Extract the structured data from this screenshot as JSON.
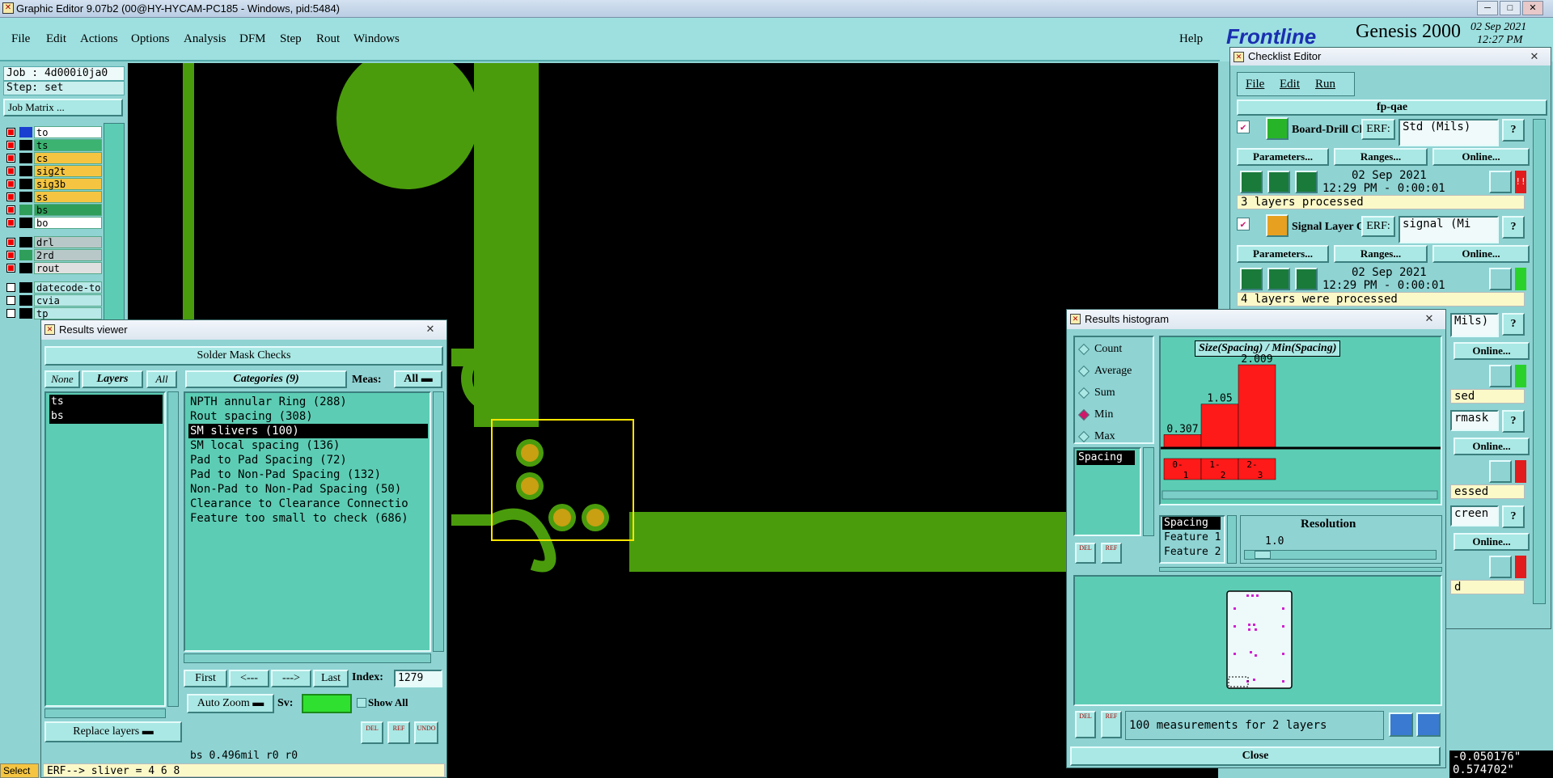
{
  "titlebar": {
    "title": "Graphic Editor 9.07b2 (00@HY-HYCAM-PC185 - Windows, pid:5484)",
    "min": "─",
    "max": "□",
    "close": "✕"
  },
  "menu": {
    "items": [
      "File",
      "Edit",
      "Actions",
      "Options",
      "Analysis",
      "DFM",
      "Step",
      "Rout",
      "Windows"
    ],
    "help": "Help"
  },
  "brand": {
    "logo": "Frontline",
    "product": "Genesis 2000",
    "date": "02 Sep 2021",
    "time": "12:27 PM"
  },
  "left": {
    "job": "Job : 4d000i0ja0",
    "step": "Step: set",
    "job_matrix": "Job Matrix ...",
    "layers": [
      {
        "name": "to",
        "color": "#ffffff",
        "checked": true
      },
      {
        "name": "ts",
        "color": "#3cb371",
        "checked": true
      },
      {
        "name": "cs",
        "color": "#f5c542",
        "checked": true
      },
      {
        "name": "sig2t",
        "color": "#f5c542",
        "checked": true
      },
      {
        "name": "sig3b",
        "color": "#f5c542",
        "checked": true
      },
      {
        "name": "ss",
        "color": "#f5c542",
        "checked": true
      },
      {
        "name": "bs",
        "color": "#2f9e5a",
        "checked": true
      },
      {
        "name": "bo",
        "color": "#ffffff",
        "checked": true
      },
      {
        "name": "drl",
        "color": "#b8c8c8",
        "checked": true
      },
      {
        "name": "2rd",
        "color": "#b8c8c8",
        "checked": true
      },
      {
        "name": "rout",
        "color": "#e0e0e0",
        "checked": true
      },
      {
        "name": "datecode-to",
        "color": "#b8e8e8",
        "checked": false
      },
      {
        "name": "cvia",
        "color": "#b8e8e8",
        "checked": false
      },
      {
        "name": "tp",
        "color": "#b8e8e8",
        "checked": false
      }
    ]
  },
  "results_viewer": {
    "title": "Results viewer",
    "close": "✕",
    "header": "Solder Mask Checks",
    "none": "None",
    "layers": "Layers",
    "all": "All",
    "categories_label": "Categories (9)",
    "meas_label": "Meas:",
    "meas_value": "All",
    "layer_list": [
      "ts",
      "bs"
    ],
    "categories": [
      "NPTH annular Ring (288)",
      "Rout spacing (308)",
      "SM slivers (100)",
      "SM local spacing (136)",
      "Pad to Pad Spacing (72)",
      "Pad to Non-Pad Spacing (132)",
      "Non-Pad to Non-Pad Spacing (50)",
      "Clearance to Clearance Connectio",
      "Feature too small to check (686)"
    ],
    "first": "First",
    "prev": "<---",
    "next": "--->",
    "last": "Last",
    "index_label": "Index:",
    "index_value": "1279",
    "auto_zoom": "Auto Zoom",
    "sv_label": "Sv:",
    "show_all": "Show All",
    "replace_layers": "Replace layers",
    "del": "DEL",
    "ref": "REF",
    "undo": "UNDO",
    "status": "bs 0.496mil  r0  r0",
    "erf": "ERF--> sliver = 4 6 8"
  },
  "histogram": {
    "title": "Results histogram",
    "close": "✕",
    "modes": [
      "Count",
      "Average",
      "Sum",
      "Min",
      "Max"
    ],
    "selected_mode": "Min",
    "list_item": "Spacing",
    "chart_title": "Size(Spacing) / Min(Spacing)",
    "bars": [
      {
        "range": "0-1",
        "value": 0.307,
        "label": "0.307",
        "r1": "0-",
        "r2": "1"
      },
      {
        "range": "1-2",
        "value": 1.05,
        "label": "1.05",
        "r1": "1-",
        "r2": "2"
      },
      {
        "range": "2-3",
        "value": 2.009,
        "label": "2.009",
        "r1": "2-",
        "r2": "3"
      }
    ],
    "fields": [
      "Spacing",
      "Feature 1",
      "Feature 2"
    ],
    "resolution_label": "Resolution",
    "resolution_value": "1.0",
    "measurements": "100 measurements for 2 layers",
    "close_btn": "Close",
    "del": "DEL",
    "ref": "REF"
  },
  "checklist": {
    "title": "Checklist Editor",
    "close": "✕",
    "menu": [
      "File",
      "Edit",
      "Run"
    ],
    "name": "fp-qae",
    "items": [
      {
        "name": "Board-Drill Che",
        "erf": "ERF:",
        "erf_value": "Std (Mils)",
        "date": "02 Sep 2021",
        "time": "12:29 PM - 0:00:01",
        "status": "3 layers processed",
        "flag": "!!",
        "flag_color": "red"
      },
      {
        "name": "Signal Layer Ch",
        "erf": "ERF:",
        "erf_value": "signal (Mi",
        "date": "02 Sep 2021",
        "time": "12:29 PM - 0:00:01",
        "status": "4 layers were processed",
        "flag": "",
        "flag_color": "green"
      }
    ],
    "params": "Parameters...",
    "ranges": "Ranges...",
    "online": "Online...",
    "partial": [
      "Mils)",
      "Online...",
      "sed",
      "rmask",
      "Online...",
      "essed",
      "creen",
      "Online...",
      "d"
    ]
  },
  "coords": {
    "x": "-0.050176\"",
    "y": "0.574702\""
  },
  "select": "Select"
}
